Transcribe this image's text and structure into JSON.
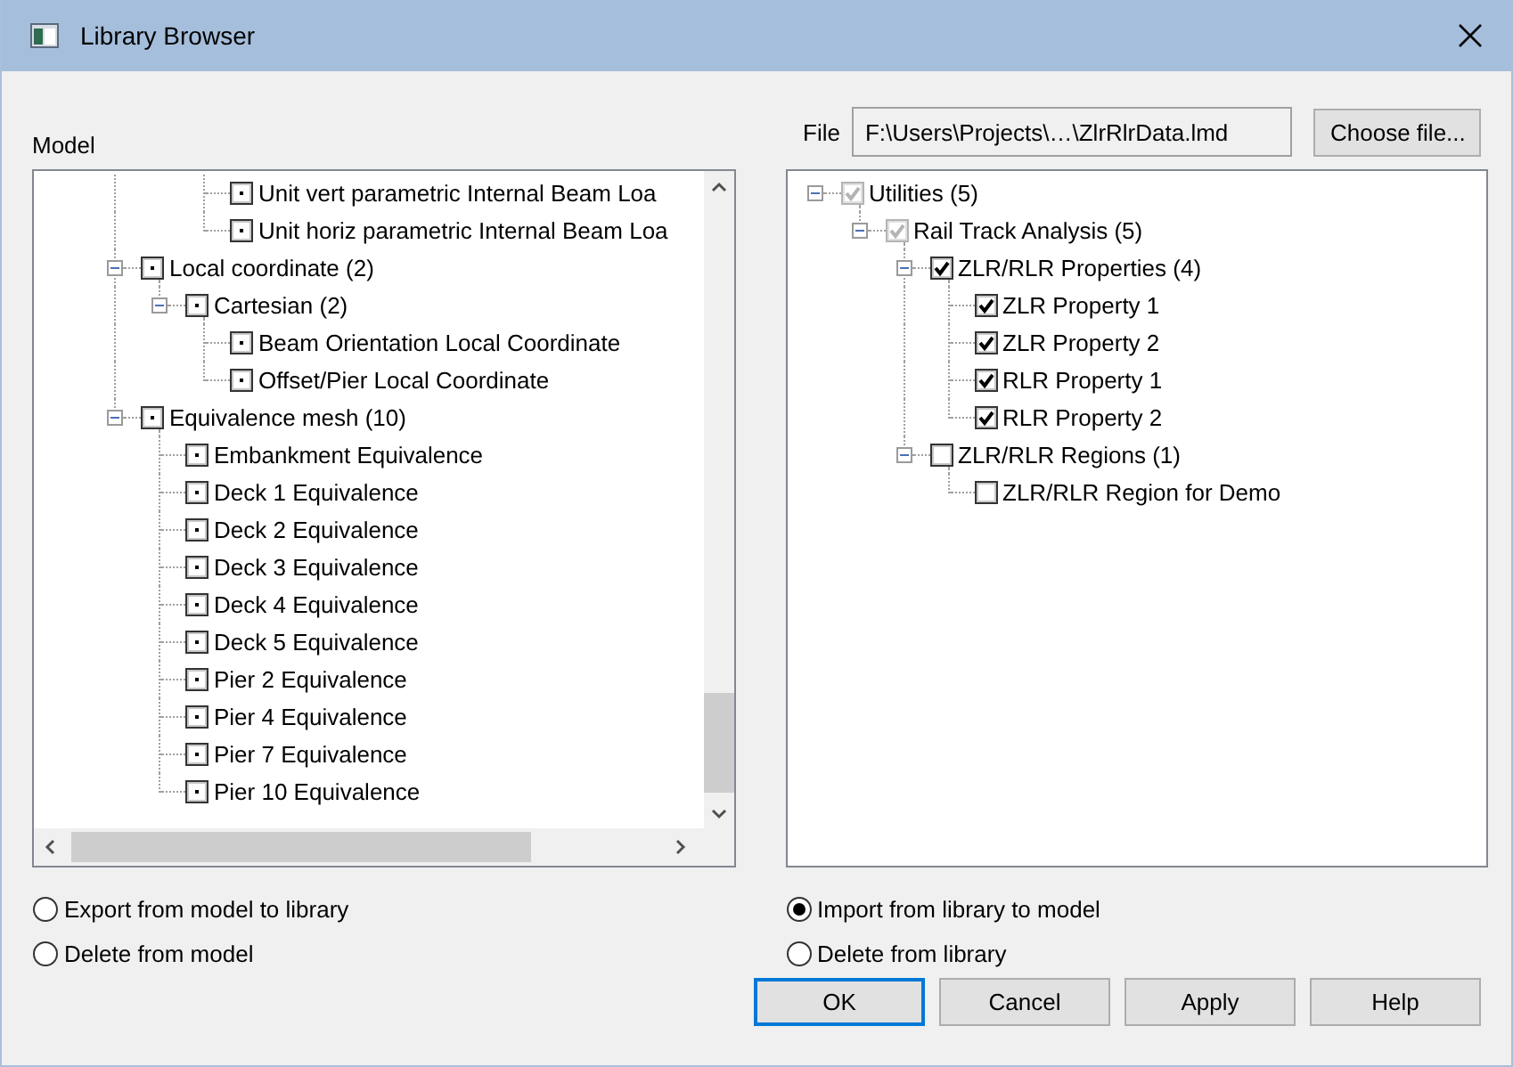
{
  "window": {
    "title": "Library Browser"
  },
  "model": {
    "label": "Model",
    "tree": [
      {
        "children": [
          {
            "children": [
              {
                "children": [
                  {
                    "label": "Unit vert parametric Internal Beam Loa",
                    "checked": false,
                    "dotted": true
                  },
                  {
                    "label": "Unit horiz parametric Internal Beam Loa",
                    "checked": false,
                    "dotted": true
                  }
                ]
              }
            ]
          },
          {
            "label": "Local coordinate (2)",
            "checked": false,
            "dotted": true,
            "expanded": true,
            "children": [
              {
                "label": "Cartesian (2)",
                "checked": false,
                "dotted": true,
                "expanded": true,
                "children": [
                  {
                    "label": "Beam Orientation Local Coordinate",
                    "checked": false,
                    "dotted": true
                  },
                  {
                    "label": "Offset/Pier Local Coordinate",
                    "checked": false,
                    "dotted": true
                  }
                ]
              }
            ]
          },
          {
            "label": "Equivalence mesh (10)",
            "checked": false,
            "dotted": true,
            "expanded": true,
            "children": [
              {
                "label": "Embankment Equivalence",
                "checked": false,
                "dotted": true
              },
              {
                "label": "Deck 1 Equivalence",
                "checked": false,
                "dotted": true
              },
              {
                "label": "Deck 2 Equivalence",
                "checked": false,
                "dotted": true
              },
              {
                "label": "Deck 3 Equivalence",
                "checked": false,
                "dotted": true
              },
              {
                "label": "Deck 4 Equivalence",
                "checked": false,
                "dotted": true
              },
              {
                "label": "Deck 5 Equivalence",
                "checked": false,
                "dotted": true
              },
              {
                "label": "Pier 2 Equivalence",
                "checked": false,
                "dotted": true
              },
              {
                "label": "Pier 4 Equivalence",
                "checked": false,
                "dotted": true
              },
              {
                "label": "Pier 7 Equivalence",
                "checked": false,
                "dotted": true
              },
              {
                "label": "Pier 10 Equivalence",
                "checked": false,
                "dotted": true
              }
            ]
          }
        ]
      }
    ],
    "options": [
      {
        "label": "Export from model to library",
        "selected": false
      },
      {
        "label": "Delete from model",
        "selected": false
      }
    ]
  },
  "library": {
    "file_label": "File",
    "file_value": "F:\\Users\\Projects\\…\\ZlrRlrData.lmd",
    "choose_button": "Choose file...",
    "tree": [
      {
        "label": "Utilities (5)",
        "checked": true,
        "disabled": true,
        "expanded": true,
        "children": [
          {
            "label": "Rail Track Analysis (5)",
            "checked": true,
            "disabled": true,
            "expanded": true,
            "children": [
              {
                "label": "ZLR/RLR Properties (4)",
                "checked": true,
                "disabled": false,
                "expanded": true,
                "children": [
                  {
                    "label": "ZLR Property 1",
                    "checked": true,
                    "disabled": false
                  },
                  {
                    "label": "ZLR Property 2",
                    "checked": true,
                    "disabled": false
                  },
                  {
                    "label": "RLR Property 1",
                    "checked": true,
                    "disabled": false
                  },
                  {
                    "label": "RLR Property 2",
                    "checked": true,
                    "disabled": false
                  }
                ]
              },
              {
                "label": "ZLR/RLR Regions (1)",
                "checked": false,
                "disabled": false,
                "expanded": true,
                "children": [
                  {
                    "label": "ZLR/RLR Region for Demo",
                    "checked": false,
                    "disabled": false
                  }
                ]
              }
            ]
          }
        ]
      }
    ],
    "options": [
      {
        "label": "Import from library to model",
        "selected": true
      },
      {
        "label": "Delete from library",
        "selected": false
      }
    ]
  },
  "buttons": [
    {
      "label": "OK",
      "focused": true
    },
    {
      "label": "Cancel",
      "focused": false
    },
    {
      "label": "Apply",
      "focused": false
    },
    {
      "label": "Help",
      "focused": false
    }
  ]
}
